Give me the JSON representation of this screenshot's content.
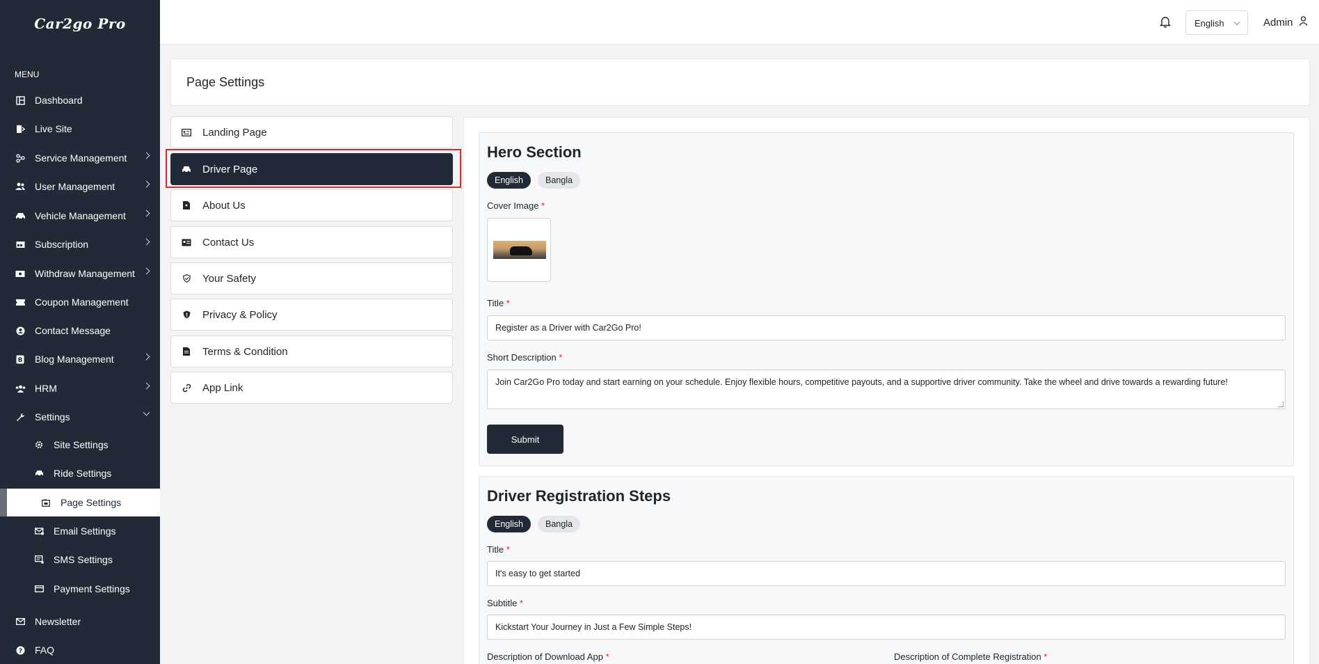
{
  "app": {
    "logo": "Car2go Pro"
  },
  "sidebar": {
    "menu_label": "MENU",
    "items": [
      {
        "label": "Dashboard",
        "icon": "dashboard-icon",
        "has_children": false
      },
      {
        "label": "Live Site",
        "icon": "live-site-icon",
        "has_children": false
      },
      {
        "label": "Service Management",
        "icon": "service-icon",
        "has_children": true
      },
      {
        "label": "User Management",
        "icon": "users-icon",
        "has_children": true
      },
      {
        "label": "Vehicle Management",
        "icon": "car-icon",
        "has_children": true
      },
      {
        "label": "Subscription",
        "icon": "subscription-icon",
        "has_children": true
      },
      {
        "label": "Withdraw Management",
        "icon": "withdraw-icon",
        "has_children": true
      },
      {
        "label": "Coupon Management",
        "icon": "coupon-icon",
        "has_children": false
      },
      {
        "label": "Contact Message",
        "icon": "contact-message-icon",
        "has_children": false
      },
      {
        "label": "Blog Management",
        "icon": "blog-icon",
        "has_children": true
      },
      {
        "label": "HRM",
        "icon": "hrm-icon",
        "has_children": true
      },
      {
        "label": "Settings",
        "icon": "wrench-icon",
        "has_children": true,
        "expanded": true
      },
      {
        "label": "Site Settings",
        "icon": "gear-icon",
        "sub": true
      },
      {
        "label": "Ride Settings",
        "icon": "car-icon",
        "sub": true
      },
      {
        "label": "Page Settings",
        "icon": "page-icon",
        "sub": true,
        "active": true
      },
      {
        "label": "Email Settings",
        "icon": "email-icon",
        "sub": true
      },
      {
        "label": "SMS Settings",
        "icon": "sms-icon",
        "sub": true
      },
      {
        "label": "Payment Settings",
        "icon": "payment-icon",
        "sub": true
      },
      {
        "label": "Newsletter",
        "icon": "newsletter-icon",
        "has_children": false
      },
      {
        "label": "FAQ",
        "icon": "faq-icon",
        "has_children": false
      }
    ]
  },
  "topbar": {
    "language": "English",
    "user": "Admin"
  },
  "page": {
    "title": "Page Settings"
  },
  "tabs": [
    {
      "label": "Landing Page",
      "icon": "landing-page-icon"
    },
    {
      "label": "Driver Page",
      "icon": "car-icon",
      "active": true
    },
    {
      "label": "About Us",
      "icon": "document-icon"
    },
    {
      "label": "Contact Us",
      "icon": "contact-card-icon"
    },
    {
      "label": "Your Safety",
      "icon": "shield-icon"
    },
    {
      "label": "Privacy & Policy",
      "icon": "shield-filled-icon"
    },
    {
      "label": "Terms & Condition",
      "icon": "file-text-icon"
    },
    {
      "label": "App Link",
      "icon": "link-icon"
    }
  ],
  "hero": {
    "heading": "Hero Section",
    "lang_tabs": [
      "English",
      "Bangla"
    ],
    "cover_label": "Cover Image",
    "title_label": "Title",
    "title_value": "Register as a Driver with Car2Go Pro!",
    "desc_label": "Short Description",
    "desc_value": "Join Car2Go Pro today and start earning on your schedule. Enjoy flexible hours, competitive payouts, and a supportive driver community. Take the wheel and drive towards a rewarding future!",
    "submit": "Submit"
  },
  "steps": {
    "heading": "Driver Registration Steps",
    "lang_tabs": [
      "English",
      "Bangla"
    ],
    "title_label": "Title",
    "title_value": "It's easy to get started",
    "subtitle_label": "Subtitle",
    "subtitle_value": "Kickstart Your Journey in Just a Few Simple Steps!",
    "download_label": "Description of Download App",
    "complete_label": "Description of Complete Registration"
  },
  "required_mark": "*"
}
